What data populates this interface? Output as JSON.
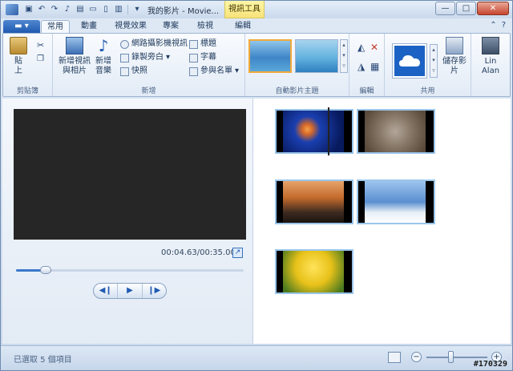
{
  "titlebar": {
    "title": "我的影片 - Movie...",
    "context_tab": "視訊工具",
    "buttons": {
      "minimize": "—",
      "maximize": "□",
      "close": "✕"
    }
  },
  "tabs": {
    "file": "▬ ▾",
    "items": [
      "常用",
      "動畫",
      "視覺效果",
      "專案",
      "檢視",
      "編輯"
    ],
    "active_index": 0
  },
  "ribbon": {
    "clipboard": {
      "paste": "貼上",
      "label": "剪貼簿"
    },
    "add": {
      "add_videos_photos": "新增視訊與相片",
      "add_music": "新增音樂",
      "webcam_video": "網路攝影機視訊",
      "record_narration": "錄製旁白",
      "snapshot": "快照",
      "title": "標題",
      "caption": "字幕",
      "credits": "參與名單",
      "label": "新增"
    },
    "themes": {
      "label": "自動影片主題"
    },
    "editing": {
      "label": "編輯"
    },
    "share": {
      "save_movie": "儲存影片",
      "label": "共用"
    },
    "user": {
      "name": "Lin Alan"
    }
  },
  "preview": {
    "timecode": "00:04.63/00:35.00",
    "seek_fraction": 0.13,
    "controls": [
      "◀❙",
      "▶",
      "❙▶"
    ]
  },
  "storyboard": {
    "clips": [
      {
        "name": "jellyfish",
        "color": "#1a3fb0"
      },
      {
        "name": "koala",
        "color": "#8a7a6a"
      },
      {
        "name": "lighthouse",
        "color": "#c46a2c"
      },
      {
        "name": "penguins",
        "color": "#5b8fd0"
      },
      {
        "name": "tulips",
        "color": "#e8c21a"
      }
    ]
  },
  "status": {
    "text": "已選取 5 個項目",
    "zoom_fraction": 0.4
  },
  "watermark": "#170329"
}
